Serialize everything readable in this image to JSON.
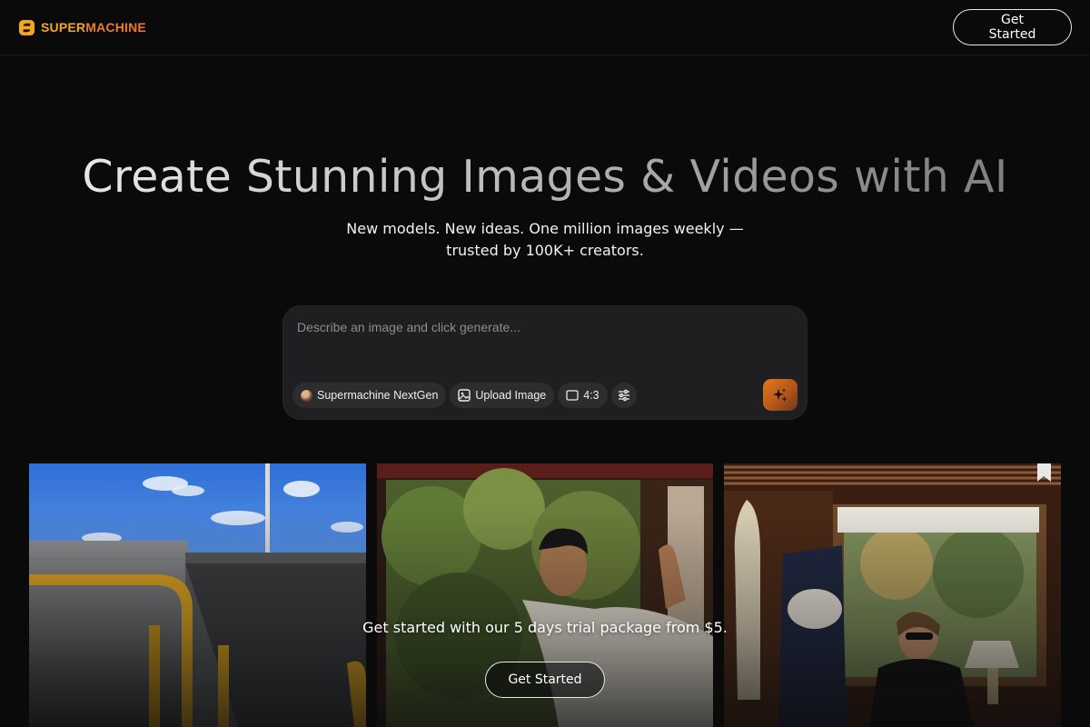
{
  "header": {
    "brand_part1": "SUPER",
    "brand_part2": "MACHINE",
    "cta_label": "Get Started"
  },
  "hero": {
    "title": "Create Stunning Images & Videos with AI",
    "subtitle": "New models. New ideas. One million images weekly — trusted by 100K+ creators."
  },
  "prompt": {
    "placeholder": "Describe an image and click generate...",
    "value": "",
    "model_label": "Supermachine NextGen",
    "upload_label": "Upload Image",
    "ratio_label": "4:3",
    "settings_icon": "sliders-icon",
    "generate_icon": "sparkle-icon"
  },
  "gallery": {
    "images": [
      "photo-rooftop-wall-yellow-rail",
      "photo-man-at-train-window",
      "photo-man-in-train-cabin"
    ]
  },
  "footer_cta": {
    "text": "Get started with our 5 days trial package from $5.",
    "button_label": "Get Started"
  },
  "colors": {
    "background": "#0a0a0b",
    "brand_orange": "#f5a524",
    "brand_deep_orange": "#f07a2a",
    "prompt_box": "#1f1f21",
    "chip": "#2d2d30"
  }
}
